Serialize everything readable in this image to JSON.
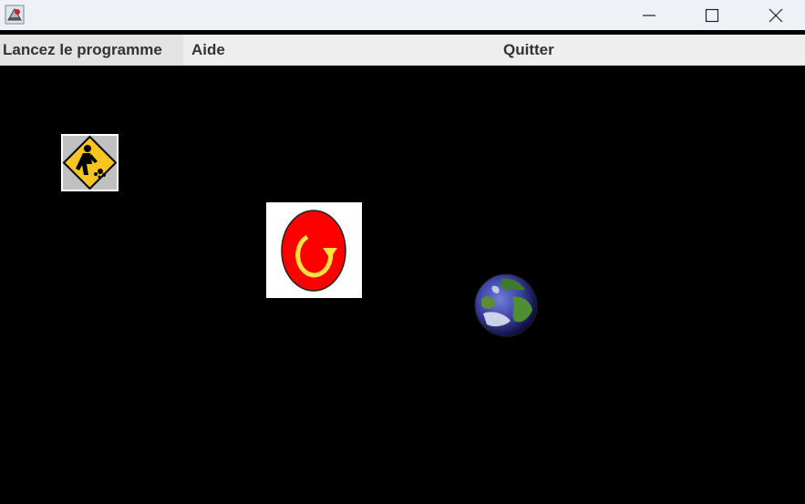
{
  "window": {
    "icon": "java-app-icon",
    "controls": {
      "minimize_icon": "minimize-icon",
      "maximize_icon": "maximize-icon",
      "close_icon": "close-icon"
    }
  },
  "menubar": {
    "items": [
      {
        "label": "Lancez le programme"
      },
      {
        "label": "Aide"
      },
      {
        "label": "Quitter"
      }
    ]
  },
  "canvas": {
    "background": "#000000",
    "sprites": [
      {
        "icon": "construction-worker-sign-icon"
      },
      {
        "icon": "restart-button-icon",
        "color": "#ff0000"
      },
      {
        "icon": "earth-globe-icon"
      }
    ]
  }
}
